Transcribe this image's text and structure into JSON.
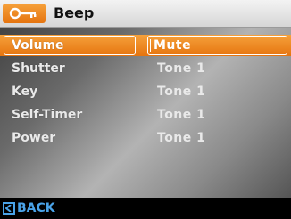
{
  "header": {
    "title": "Beep",
    "icon": "key-icon"
  },
  "menu": {
    "items": [
      {
        "label": "Volume",
        "value": "Mute",
        "selected": true
      },
      {
        "label": "Shutter",
        "value": "Tone 1",
        "selected": false
      },
      {
        "label": "Key",
        "value": "Tone 1",
        "selected": false
      },
      {
        "label": "Self-Timer",
        "value": "Tone 1",
        "selected": false
      },
      {
        "label": "Power",
        "value": "Tone 1",
        "selected": false
      }
    ]
  },
  "footer": {
    "back_label": "BACK",
    "back_icon": "back-arrow-icon"
  },
  "colors": {
    "accent": "#f08a1f",
    "back": "#4aa3e8"
  }
}
